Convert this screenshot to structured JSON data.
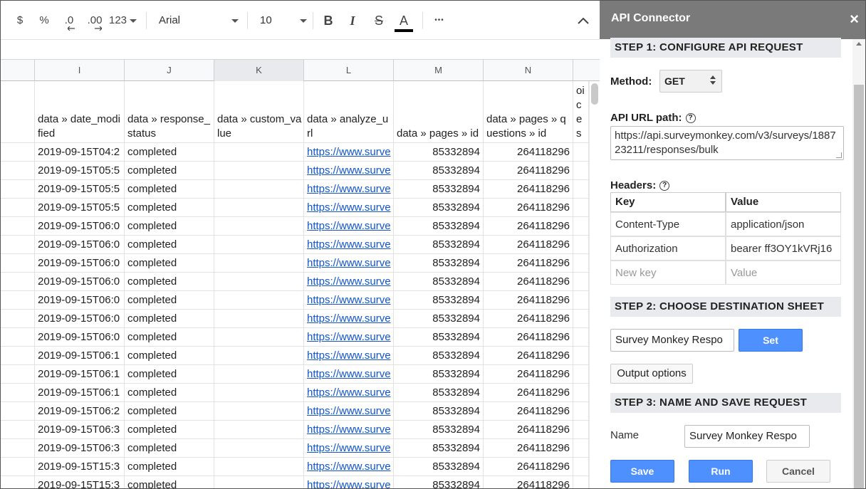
{
  "toolbar": {
    "currency": "$",
    "percent": "%",
    "decrease_decimal": ".0",
    "increase_decimal": ".00",
    "more_formats": "123",
    "font": "Arial",
    "font_size": "10",
    "bold": "B",
    "italic": "I",
    "strike": "S",
    "text_color": "A",
    "more": "•••",
    "text_color_swatch": "#000000"
  },
  "columns": [
    "I",
    "J",
    "K",
    "L",
    "M",
    "N"
  ],
  "header_cells": {
    "I": "data » date_modified",
    "J": "data » response_status",
    "K": "data » custom_value",
    "L": "data » analyze_url",
    "M": "data » pages » id",
    "N": "data » pages » questions » id",
    "O": "data » questions » answers » choices"
  },
  "rows": [
    {
      "date": "2019-09-15T04:2",
      "status": "completed",
      "url": "https://www.surve",
      "page_id": "85332894",
      "q_id": "264118296"
    },
    {
      "date": "2019-09-15T05:5",
      "status": "completed",
      "url": "https://www.surve",
      "page_id": "85332894",
      "q_id": "264118296"
    },
    {
      "date": "2019-09-15T05:5",
      "status": "completed",
      "url": "https://www.surve",
      "page_id": "85332894",
      "q_id": "264118296"
    },
    {
      "date": "2019-09-15T05:5",
      "status": "completed",
      "url": "https://www.surve",
      "page_id": "85332894",
      "q_id": "264118296"
    },
    {
      "date": "2019-09-15T06:0",
      "status": "completed",
      "url": "https://www.surve",
      "page_id": "85332894",
      "q_id": "264118296"
    },
    {
      "date": "2019-09-15T06:0",
      "status": "completed",
      "url": "https://www.surve",
      "page_id": "85332894",
      "q_id": "264118296"
    },
    {
      "date": "2019-09-15T06:0",
      "status": "completed",
      "url": "https://www.surve",
      "page_id": "85332894",
      "q_id": "264118296"
    },
    {
      "date": "2019-09-15T06:0",
      "status": "completed",
      "url": "https://www.surve",
      "page_id": "85332894",
      "q_id": "264118296"
    },
    {
      "date": "2019-09-15T06:0",
      "status": "completed",
      "url": "https://www.surve",
      "page_id": "85332894",
      "q_id": "264118296"
    },
    {
      "date": "2019-09-15T06:0",
      "status": "completed",
      "url": "https://www.surve",
      "page_id": "85332894",
      "q_id": "264118296"
    },
    {
      "date": "2019-09-15T06:0",
      "status": "completed",
      "url": "https://www.surve",
      "page_id": "85332894",
      "q_id": "264118296"
    },
    {
      "date": "2019-09-15T06:1",
      "status": "completed",
      "url": "https://www.surve",
      "page_id": "85332894",
      "q_id": "264118296"
    },
    {
      "date": "2019-09-15T06:1",
      "status": "completed",
      "url": "https://www.surve",
      "page_id": "85332894",
      "q_id": "264118296"
    },
    {
      "date": "2019-09-15T06:1",
      "status": "completed",
      "url": "https://www.surve",
      "page_id": "85332894",
      "q_id": "264118296"
    },
    {
      "date": "2019-09-15T06:2",
      "status": "completed",
      "url": "https://www.surve",
      "page_id": "85332894",
      "q_id": "264118296"
    },
    {
      "date": "2019-09-15T06:3",
      "status": "completed",
      "url": "https://www.surve",
      "page_id": "85332894",
      "q_id": "264118296"
    },
    {
      "date": "2019-09-15T06:3",
      "status": "completed",
      "url": "https://www.surve",
      "page_id": "85332894",
      "q_id": "264118296"
    },
    {
      "date": "2019-09-15T15:3",
      "status": "completed",
      "url": "https://www.surve",
      "page_id": "85332894",
      "q_id": "264118296"
    },
    {
      "date": "2019-09-15T15:3",
      "status": "completed",
      "url": "https://www.surve",
      "page_id": "85332894",
      "q_id": "264118296"
    }
  ],
  "panel": {
    "title": "API Connector",
    "close": "×",
    "step1": "STEP 1: CONFIGURE API REQUEST",
    "method_label": "Method:",
    "method_value": "GET",
    "url_label": "API URL path:",
    "url_value": "https://api.surveymonkey.com/v3/surveys/188723211/responses/bulk",
    "headers_label": "Headers:",
    "help": "?",
    "headers_table": {
      "key_col": "Key",
      "value_col": "Value",
      "rows": [
        {
          "key": "Content-Type",
          "value": "application/json"
        },
        {
          "key": "Authorization",
          "value": "bearer ff3OY1kVRj16"
        }
      ],
      "new_key_placeholder": "New key",
      "new_value_placeholder": "Value"
    },
    "step2": "STEP 2: CHOOSE DESTINATION SHEET",
    "dest_sheet": "Survey Monkey Respo",
    "set_button": "Set",
    "output_options": "Output options",
    "step3": "STEP 3: NAME AND SAVE REQUEST",
    "name_label": "Name",
    "name_value": "Survey Monkey Respo",
    "save_button": "Save",
    "run_button": "Run",
    "cancel_button": "Cancel"
  }
}
